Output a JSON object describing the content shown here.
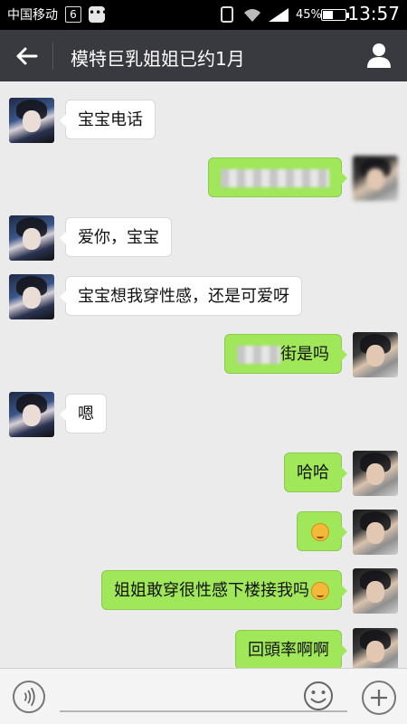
{
  "status_bar": {
    "carrier": "中国移动",
    "sim_badge": "6",
    "message_icon": "chat-bubble-icon",
    "battery_percent": "45%",
    "battery_level": 0.45,
    "time": "13:57"
  },
  "header": {
    "title": "模特巨乳姐姐已约1月",
    "back_icon": "back-arrow-icon",
    "profile_icon": "person-icon",
    "background": "#393a3f"
  },
  "messages": [
    {
      "side": "left",
      "text": "宝宝电话"
    },
    {
      "side": "right",
      "text": ""
    },
    {
      "side": "left",
      "text": "爱你，宝宝"
    },
    {
      "side": "left",
      "text": "宝宝想我穿性感，还是可爱呀"
    },
    {
      "side": "right",
      "text": "街是吗"
    },
    {
      "side": "left",
      "text": "嗯"
    },
    {
      "side": "right",
      "text": "哈哈"
    },
    {
      "side": "right",
      "text": ""
    },
    {
      "side": "right",
      "text": "姐姐敢穿很性感下楼接我吗"
    },
    {
      "side": "right",
      "text": "回頭率啊啊"
    }
  ],
  "colors": {
    "outgoing_bubble": "#a0e75a",
    "incoming_bubble": "#ffffff",
    "chat_background": "#ebebeb"
  },
  "input_bar": {
    "value": "",
    "voice_icon": "voice-icon",
    "emoji_icon": "emoji-icon",
    "plus_icon": "plus-icon"
  }
}
